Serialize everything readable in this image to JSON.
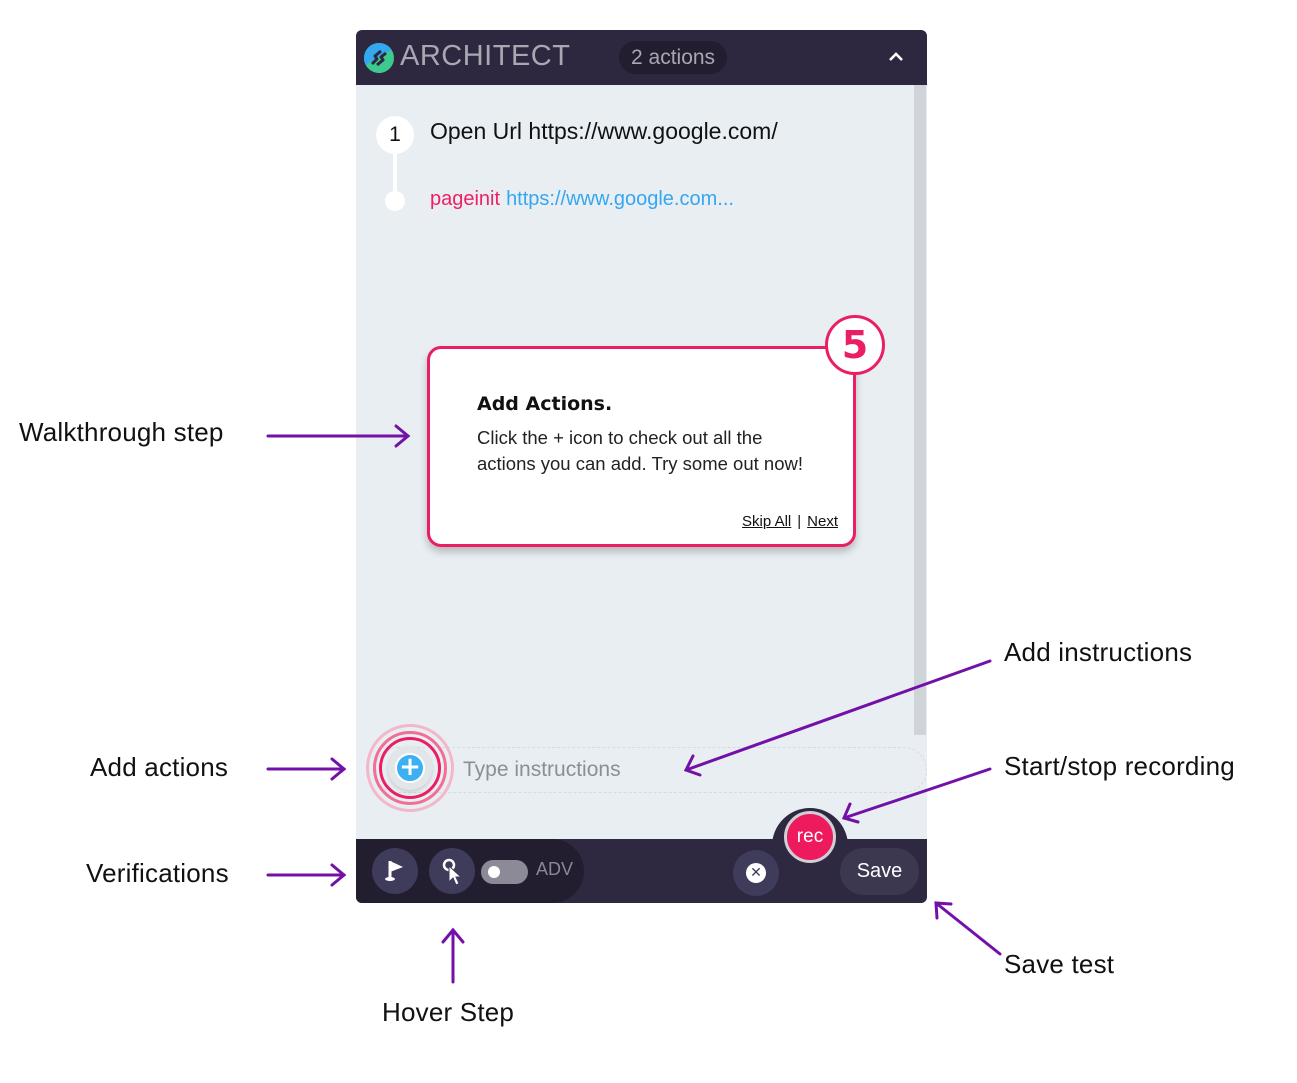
{
  "annotations": {
    "walkthrough_step": "Walkthrough step",
    "add_actions": "Add actions",
    "verifications": "Verifications",
    "hover_step": "Hover Step",
    "add_instructions": "Add instructions",
    "start_stop_recording": "Start/stop recording",
    "save_test": "Save test",
    "arrow_color": "#7310a8"
  },
  "header": {
    "brand": "ARCHITECT",
    "action_count": "2 actions",
    "collapse_icon": "chevron-up-icon"
  },
  "steps": [
    {
      "number": "1",
      "title": "Open Url https://www.google.com/",
      "event": "pageinit",
      "url": "https://www.google.com..."
    }
  ],
  "walkthrough": {
    "step_number": "5",
    "title": "Add Actions.",
    "body": "Click the + icon to check out all the actions you can add. Try some out now!",
    "skip_label": "Skip All",
    "separator": "|",
    "next_label": "Next"
  },
  "instructions": {
    "placeholder": "Type instructions",
    "value": ""
  },
  "footer": {
    "adv_label": "ADV",
    "adv_enabled": false,
    "rec_label": "rec",
    "save_label": "Save"
  },
  "colors": {
    "header_bg": "#2d2840",
    "accent_pink": "#ea1e63",
    "link_blue": "#35a7f0",
    "panel_bg": "#e9eef2"
  }
}
